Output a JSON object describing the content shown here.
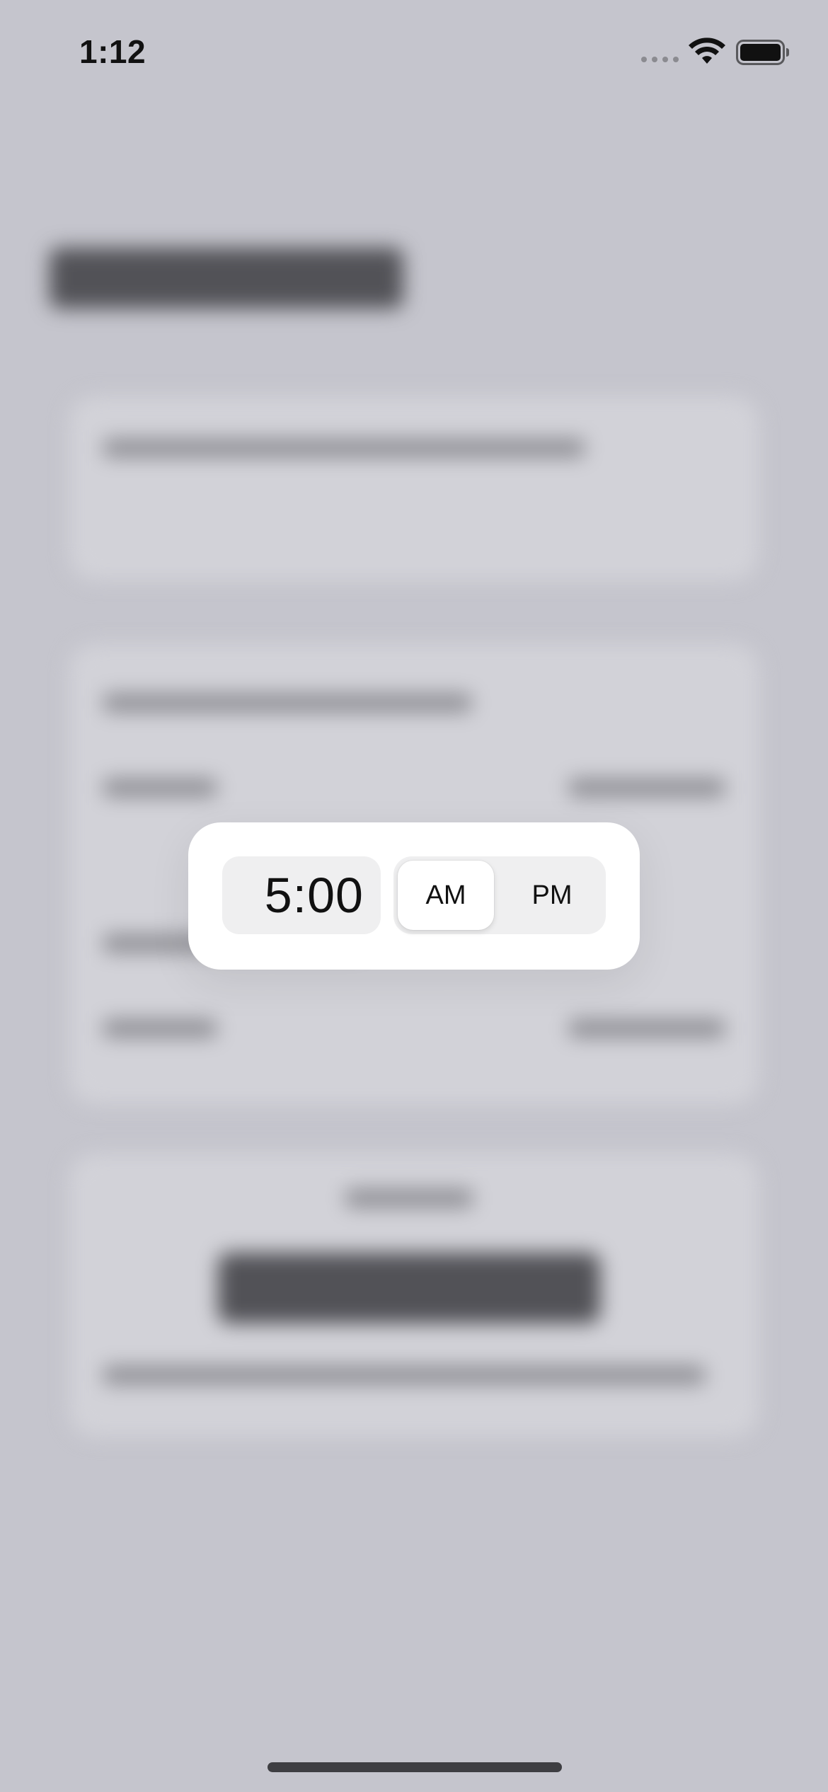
{
  "status_bar": {
    "time": "1:12",
    "signal_icon": "signal-dots-icon",
    "wifi_icon": "wifi-icon",
    "battery_icon": "battery-icon"
  },
  "time_picker": {
    "time_value": "5:00",
    "am_label": "AM",
    "pm_label": "PM",
    "selected_period": "AM"
  },
  "colors": {
    "background_overlay": "#c5c5cd",
    "popover_bg": "#ffffff",
    "field_bg": "#efeff0"
  }
}
